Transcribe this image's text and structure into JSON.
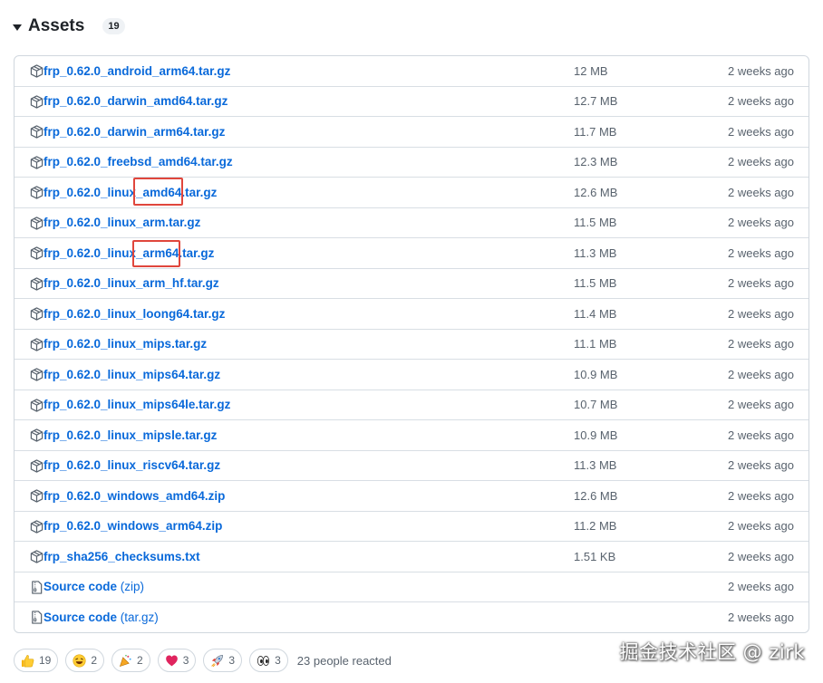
{
  "header": {
    "title": "Assets",
    "count": "19"
  },
  "assets": [
    {
      "name": "frp_0.62.0_android_arm64.tar.gz",
      "suffix": "",
      "size": "12 MB",
      "time": "2 weeks ago",
      "icon": "package-icon"
    },
    {
      "name": "frp_0.62.0_darwin_amd64.tar.gz",
      "suffix": "",
      "size": "12.7 MB",
      "time": "2 weeks ago",
      "icon": "package-icon"
    },
    {
      "name": "frp_0.62.0_darwin_arm64.tar.gz",
      "suffix": "",
      "size": "11.7 MB",
      "time": "2 weeks ago",
      "icon": "package-icon"
    },
    {
      "name": "frp_0.62.0_freebsd_amd64.tar.gz",
      "suffix": "",
      "size": "12.3 MB",
      "time": "2 weeks ago",
      "icon": "package-icon"
    },
    {
      "name": "frp_0.62.0_linux_amd64.tar.gz",
      "suffix": "",
      "size": "12.6 MB",
      "time": "2 weeks ago",
      "icon": "package-icon"
    },
    {
      "name": "frp_0.62.0_linux_arm.tar.gz",
      "suffix": "",
      "size": "11.5 MB",
      "time": "2 weeks ago",
      "icon": "package-icon"
    },
    {
      "name": "frp_0.62.0_linux_arm64.tar.gz",
      "suffix": "",
      "size": "11.3 MB",
      "time": "2 weeks ago",
      "icon": "package-icon"
    },
    {
      "name": "frp_0.62.0_linux_arm_hf.tar.gz",
      "suffix": "",
      "size": "11.5 MB",
      "time": "2 weeks ago",
      "icon": "package-icon"
    },
    {
      "name": "frp_0.62.0_linux_loong64.tar.gz",
      "suffix": "",
      "size": "11.4 MB",
      "time": "2 weeks ago",
      "icon": "package-icon"
    },
    {
      "name": "frp_0.62.0_linux_mips.tar.gz",
      "suffix": "",
      "size": "11.1 MB",
      "time": "2 weeks ago",
      "icon": "package-icon"
    },
    {
      "name": "frp_0.62.0_linux_mips64.tar.gz",
      "suffix": "",
      "size": "10.9 MB",
      "time": "2 weeks ago",
      "icon": "package-icon"
    },
    {
      "name": "frp_0.62.0_linux_mips64le.tar.gz",
      "suffix": "",
      "size": "10.7 MB",
      "time": "2 weeks ago",
      "icon": "package-icon"
    },
    {
      "name": "frp_0.62.0_linux_mipsle.tar.gz",
      "suffix": "",
      "size": "10.9 MB",
      "time": "2 weeks ago",
      "icon": "package-icon"
    },
    {
      "name": "frp_0.62.0_linux_riscv64.tar.gz",
      "suffix": "",
      "size": "11.3 MB",
      "time": "2 weeks ago",
      "icon": "package-icon"
    },
    {
      "name": "frp_0.62.0_windows_amd64.zip",
      "suffix": "",
      "size": "12.6 MB",
      "time": "2 weeks ago",
      "icon": "package-icon"
    },
    {
      "name": "frp_0.62.0_windows_arm64.zip",
      "suffix": "",
      "size": "11.2 MB",
      "time": "2 weeks ago",
      "icon": "package-icon"
    },
    {
      "name": "frp_sha256_checksums.txt",
      "suffix": "",
      "size": "1.51 KB",
      "time": "2 weeks ago",
      "icon": "package-icon"
    },
    {
      "name": "Source code",
      "suffix": " (zip)",
      "size": "",
      "time": "2 weeks ago",
      "icon": "file-zip-icon"
    },
    {
      "name": "Source code",
      "suffix": " (tar.gz)",
      "size": "",
      "time": "2 weeks ago",
      "icon": "file-zip-icon"
    }
  ],
  "reactions": [
    {
      "emoji": "thumbs-up-icon",
      "count": "19"
    },
    {
      "emoji": "laugh-icon",
      "count": "2"
    },
    {
      "emoji": "hooray-icon",
      "count": "2"
    },
    {
      "emoji": "heart-icon",
      "count": "3"
    },
    {
      "emoji": "rocket-icon",
      "count": "3"
    },
    {
      "emoji": "eyes-icon",
      "count": "3"
    }
  ],
  "reacted_text": "23 people reacted",
  "watermark": "掘金技术社区 @ zirk",
  "colors": {
    "link": "#0969da",
    "muted": "#59636e",
    "highlight": "#e0463c",
    "border": "#d0d7de"
  }
}
